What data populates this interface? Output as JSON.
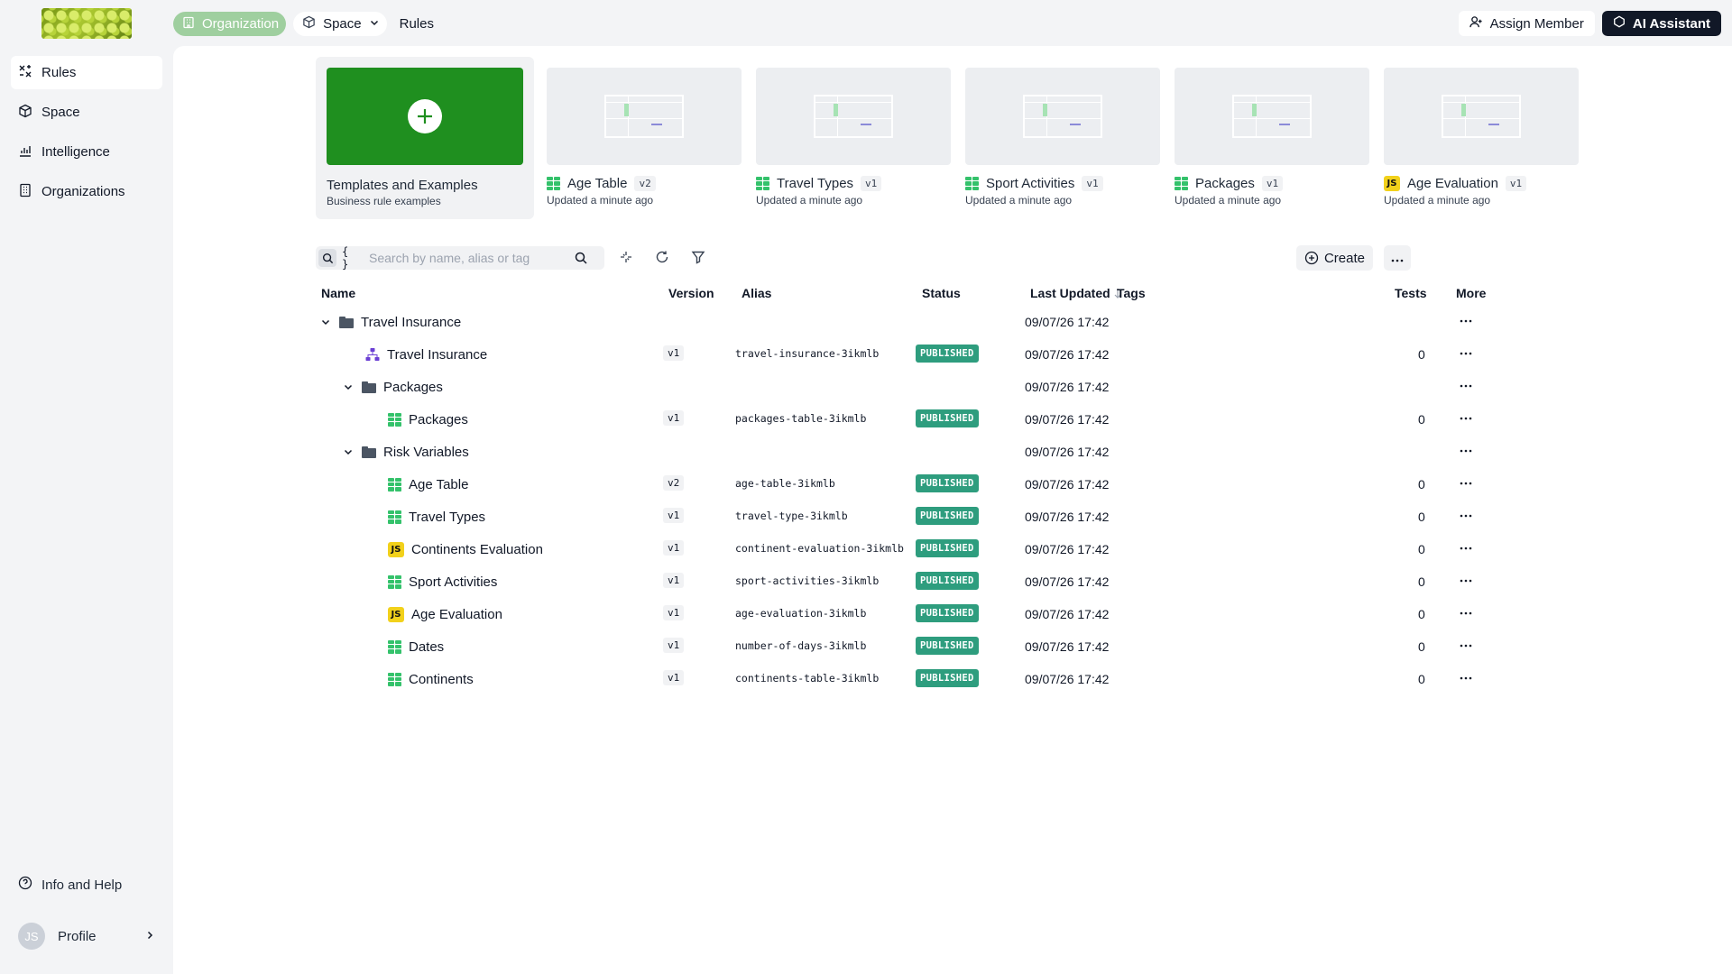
{
  "header": {
    "breadcrumb": {
      "organization": "Organization",
      "space": "Space",
      "rules": "Rules"
    },
    "assign_member": "Assign Member",
    "ai_assistant": "AI Assistant"
  },
  "sidebar": {
    "items": [
      {
        "label": "Rules",
        "icon": "rules-icon",
        "active": true
      },
      {
        "label": "Space",
        "icon": "cube-icon",
        "active": false
      },
      {
        "label": "Intelligence",
        "icon": "chart-icon",
        "active": false
      },
      {
        "label": "Organizations",
        "icon": "building-icon",
        "active": false
      }
    ],
    "info_help": "Info and Help",
    "profile_label": "Profile",
    "avatar_initials": "JS"
  },
  "cards": {
    "templates": {
      "title": "Templates and Examples",
      "subtitle": "Business rule examples"
    },
    "recent": [
      {
        "title": "Age Table",
        "version": "v2",
        "updated": "Updated a minute ago",
        "type": "table"
      },
      {
        "title": "Travel Types",
        "version": "v1",
        "updated": "Updated a minute ago",
        "type": "table"
      },
      {
        "title": "Sport Activities",
        "version": "v1",
        "updated": "Updated a minute ago",
        "type": "table"
      },
      {
        "title": "Packages",
        "version": "v1",
        "updated": "Updated a minute ago",
        "type": "table"
      },
      {
        "title": "Age Evaluation",
        "version": "v1",
        "updated": "Updated a minute ago",
        "type": "js"
      }
    ]
  },
  "toolbar": {
    "search_placeholder": "Search by name, alias or tag",
    "braces": "{ }",
    "create_label": "Create"
  },
  "table": {
    "headers": {
      "name": "Name",
      "version": "Version",
      "alias": "Alias",
      "status": "Status",
      "last_updated": "Last Updated",
      "tags": "Tags",
      "tests": "Tests",
      "more": "More"
    },
    "rows": [
      {
        "kind": "folder",
        "depth": 0,
        "name": "Travel Insurance",
        "version": "",
        "alias": "",
        "status": "",
        "date": "09/07/26 17:42",
        "tests": ""
      },
      {
        "kind": "flow",
        "depth": 1,
        "name": "Travel Insurance",
        "version": "v1",
        "alias": "travel-insurance-3ikmlb",
        "status": "PUBLISHED",
        "date": "09/07/26 17:42",
        "tests": "0"
      },
      {
        "kind": "folder",
        "depth": 1,
        "name": "Packages",
        "version": "",
        "alias": "",
        "status": "",
        "date": "09/07/26 17:42",
        "tests": ""
      },
      {
        "kind": "table",
        "depth": 2,
        "name": "Packages",
        "version": "v1",
        "alias": "packages-table-3ikmlb",
        "status": "PUBLISHED",
        "date": "09/07/26 17:42",
        "tests": "0"
      },
      {
        "kind": "folder",
        "depth": 1,
        "name": "Risk Variables",
        "version": "",
        "alias": "",
        "status": "",
        "date": "09/07/26 17:42",
        "tests": ""
      },
      {
        "kind": "table",
        "depth": 2,
        "name": "Age Table",
        "version": "v2",
        "alias": "age-table-3ikmlb",
        "status": "PUBLISHED",
        "date": "09/07/26 17:42",
        "tests": "0"
      },
      {
        "kind": "table",
        "depth": 2,
        "name": "Travel Types",
        "version": "v1",
        "alias": "travel-type-3ikmlb",
        "status": "PUBLISHED",
        "date": "09/07/26 17:42",
        "tests": "0"
      },
      {
        "kind": "js",
        "depth": 2,
        "name": "Continents Evaluation",
        "version": "v1",
        "alias": "continent-evaluation-3ikmlb",
        "status": "PUBLISHED",
        "date": "09/07/26 17:42",
        "tests": "0"
      },
      {
        "kind": "table",
        "depth": 2,
        "name": "Sport Activities",
        "version": "v1",
        "alias": "sport-activities-3ikmlb",
        "status": "PUBLISHED",
        "date": "09/07/26 17:42",
        "tests": "0"
      },
      {
        "kind": "js",
        "depth": 2,
        "name": "Age Evaluation",
        "version": "v1",
        "alias": "age-evaluation-3ikmlb",
        "status": "PUBLISHED",
        "date": "09/07/26 17:42",
        "tests": "0"
      },
      {
        "kind": "table",
        "depth": 2,
        "name": "Dates",
        "version": "v1",
        "alias": "number-of-days-3ikmlb",
        "status": "PUBLISHED",
        "date": "09/07/26 17:42",
        "tests": "0"
      },
      {
        "kind": "table",
        "depth": 2,
        "name": "Continents",
        "version": "v1",
        "alias": "continents-table-3ikmlb",
        "status": "PUBLISHED",
        "date": "09/07/26 17:42",
        "tests": "0"
      }
    ]
  },
  "colors": {
    "accent_green": "#1f8f1f",
    "published_badge": "#2e9d7e",
    "table_icon": "#34c26b",
    "js_icon": "#f2d11b",
    "flow_icon": "#6b3fd4"
  }
}
